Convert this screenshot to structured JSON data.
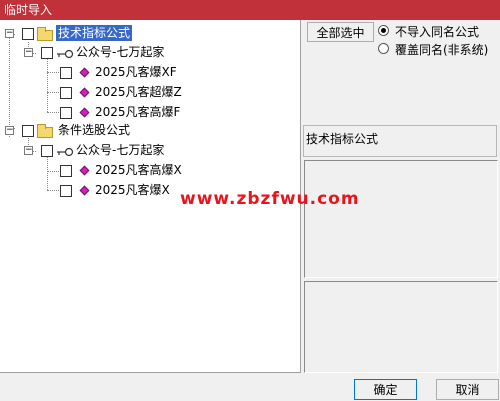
{
  "window": {
    "title": "临时导入"
  },
  "tree": {
    "groups": [
      {
        "label": "技术指标公式",
        "folder": "公众号-七万起家",
        "items": [
          "2025凡客爆XF",
          "2025凡客超爆Z",
          "2025凡客高爆F"
        ]
      },
      {
        "label": "条件选股公式",
        "folder": "公众号-七万起家",
        "items": [
          "2025凡客高爆X",
          "2025凡客爆X"
        ]
      }
    ]
  },
  "options": {
    "select_all_label": "全部选中",
    "radio_skip_label": "不导入同名公式",
    "radio_overwrite_label": "覆盖同名(非系统)",
    "selected": "skip"
  },
  "description": {
    "title": "技术指标公式"
  },
  "watermark": "www.zbzfwu.com",
  "buttons": {
    "ok_label": "确定",
    "cancel_label": "取消"
  }
}
